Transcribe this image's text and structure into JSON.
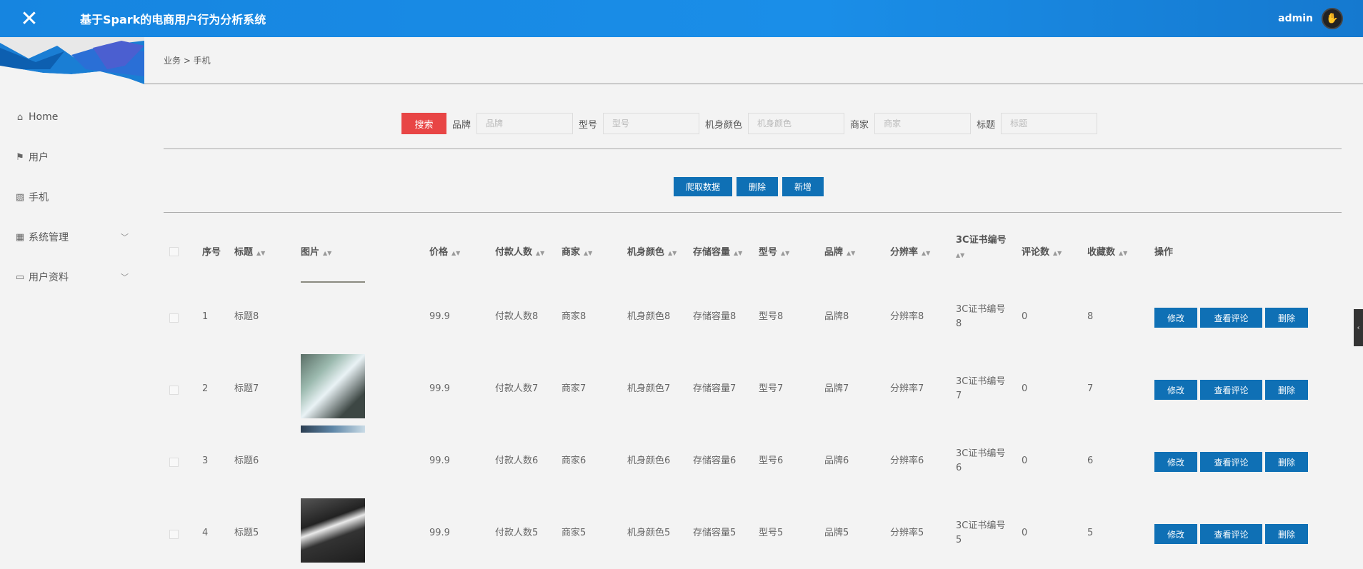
{
  "header": {
    "close_icon": "close-icon",
    "title": "基于Spark的电商用户行为分析系统",
    "user": "admin"
  },
  "sidebar": {
    "items": [
      {
        "label": "Home",
        "icon": "home-icon"
      },
      {
        "label": "用户",
        "icon": "flag-icon"
      },
      {
        "label": "手机",
        "icon": "chart-icon"
      },
      {
        "label": "系统管理",
        "icon": "grid-icon",
        "expandable": true
      },
      {
        "label": "用户资料",
        "icon": "card-icon",
        "expandable": true
      }
    ]
  },
  "breadcrumb": "业务 > 手机",
  "search": {
    "button": "搜索",
    "fields": [
      {
        "label": "品牌",
        "placeholder": "品牌"
      },
      {
        "label": "型号",
        "placeholder": "型号"
      },
      {
        "label": "机身颜色",
        "placeholder": "机身颜色"
      },
      {
        "label": "商家",
        "placeholder": "商家"
      },
      {
        "label": "标题",
        "placeholder": "标题"
      }
    ]
  },
  "actions": {
    "crawl": "爬取数据",
    "delete": "删除",
    "add": "新增"
  },
  "table": {
    "headers": {
      "index": "序号",
      "title": "标题",
      "image": "图片",
      "price": "价格",
      "payers": "付款人数",
      "merchant": "商家",
      "color": "机身颜色",
      "storage": "存储容量",
      "model": "型号",
      "brand": "品牌",
      "resolution": "分辨率",
      "cert_a": "3C证书编号",
      "comments": "评论数",
      "favorites": "收藏数",
      "ops": "操作"
    },
    "rows": [
      {
        "index": "1",
        "title": "标题8",
        "price": "99.9",
        "payers": "付款人数8",
        "merchant": "商家8",
        "color": "机身颜色8",
        "storage": "存储容量8",
        "model": "型号8",
        "brand": "品牌8",
        "resolution": "分辨率8",
        "cert_a": "3C证书编号",
        "cert_b": "8",
        "comments": "0",
        "favorites": "8"
      },
      {
        "index": "2",
        "title": "标题7",
        "price": "99.9",
        "payers": "付款人数7",
        "merchant": "商家7",
        "color": "机身颜色7",
        "storage": "存储容量7",
        "model": "型号7",
        "brand": "品牌7",
        "resolution": "分辨率7",
        "cert_a": "3C证书编号",
        "cert_b": "7",
        "comments": "0",
        "favorites": "7"
      },
      {
        "index": "3",
        "title": "标题6",
        "price": "99.9",
        "payers": "付款人数6",
        "merchant": "商家6",
        "color": "机身颜色6",
        "storage": "存储容量6",
        "model": "型号6",
        "brand": "品牌6",
        "resolution": "分辨率6",
        "cert_a": "3C证书编号",
        "cert_b": "6",
        "comments": "0",
        "favorites": "6"
      },
      {
        "index": "4",
        "title": "标题5",
        "price": "99.9",
        "payers": "付款人数5",
        "merchant": "商家5",
        "color": "机身颜色5",
        "storage": "存储容量5",
        "model": "型号5",
        "brand": "品牌5",
        "resolution": "分辨率5",
        "cert_a": "3C证书编号",
        "cert_b": "5",
        "comments": "0",
        "favorites": "5"
      }
    ],
    "row_buttons": {
      "edit": "修改",
      "comments": "查看评论",
      "delete": "删除"
    }
  }
}
